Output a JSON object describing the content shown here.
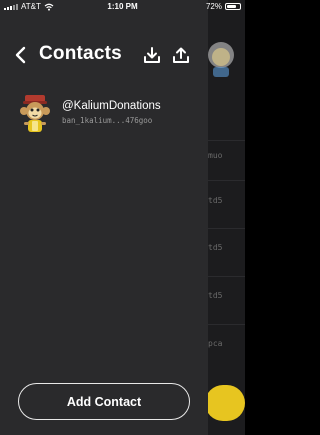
{
  "status_bar": {
    "carrier": "AT&T",
    "time": "1:10 PM",
    "battery": "72%",
    "battery_level": 0.72
  },
  "header": {
    "title": "Contacts",
    "back_icon": "chevron-left-icon",
    "download_icon": "download-icon",
    "upload_icon": "upload-icon"
  },
  "contacts": [
    {
      "name": "@KaliumDonations",
      "address": "ban_1kalium...476goo"
    }
  ],
  "add_contact_label": "Add Contact",
  "background": {
    "snippets": [
      "muo",
      "td5",
      "td5",
      "td5",
      "pca"
    ]
  },
  "colors": {
    "drawer_bg": "#2a2a2c",
    "app_bg": "#1c1c1e",
    "accent_yellow": "#e7c520",
    "text_secondary": "#9a9a9a"
  }
}
